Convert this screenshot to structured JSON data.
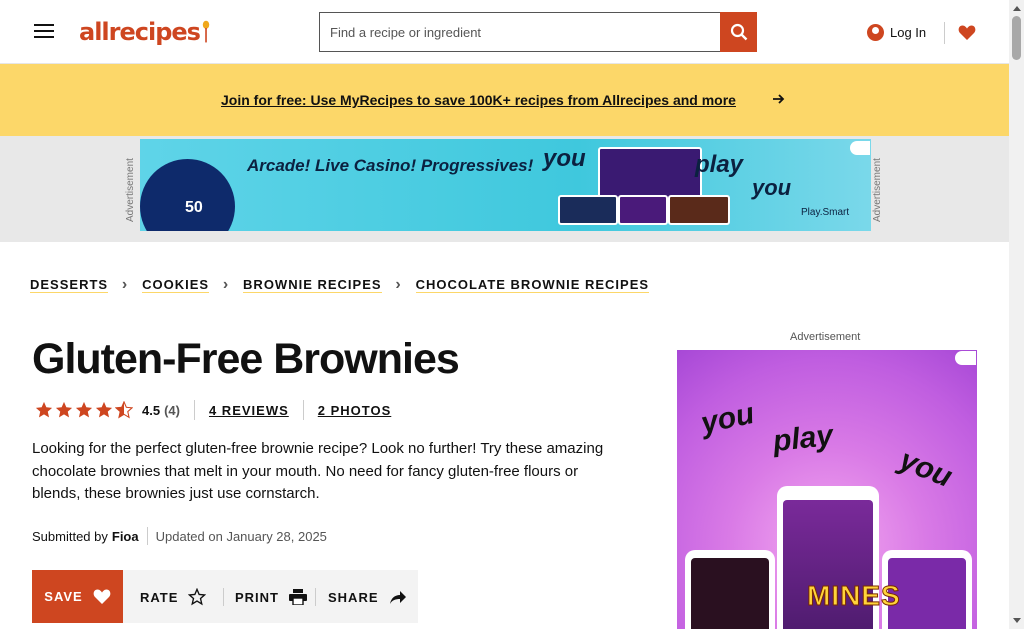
{
  "header": {
    "logo_text": "allrecipes",
    "search_placeholder": "Find a recipe or ingredient",
    "login_label": "Log In"
  },
  "promo": {
    "link_text": "Join for free: Use MyRecipes to save 100K+ recipes from Allrecipes and more"
  },
  "top_ad": {
    "side_label": "Advertisement",
    "tagline": "Arcade! Live Casino! Progressives!",
    "you": "you",
    "play": "play",
    "brand": "Play.Smart",
    "badge_text": "50"
  },
  "breadcrumbs": [
    "DESSERTS",
    "COOKIES",
    "BROWNIE RECIPES",
    "CHOCOLATE BROWNIE RECIPES"
  ],
  "recipe": {
    "title": "Gluten-Free Brownies",
    "rating_value": "4.5",
    "rating_count": "(4)",
    "reviews_link": "4 REVIEWS",
    "photos_link": "2 PHOTOS",
    "description": "Looking for the perfect gluten-free brownie recipe? Look no further! Try these amazing chocolate brownies that melt in your mouth. No need for fancy gluten-free flours or blends, these brownies just use cornstarch.",
    "submitted_by_label": "Submitted by",
    "author": "Fioa",
    "updated": "Updated on January 28, 2025"
  },
  "actions": {
    "save": "SAVE",
    "rate": "RATE",
    "print": "PRINT",
    "share": "SHARE"
  },
  "side_ad": {
    "label": "Advertisement",
    "you1": "you",
    "play": "play",
    "you2": "you",
    "game_name": "MINES"
  },
  "colors": {
    "brand": "#ce4620",
    "promo_bg": "#fcd769"
  }
}
